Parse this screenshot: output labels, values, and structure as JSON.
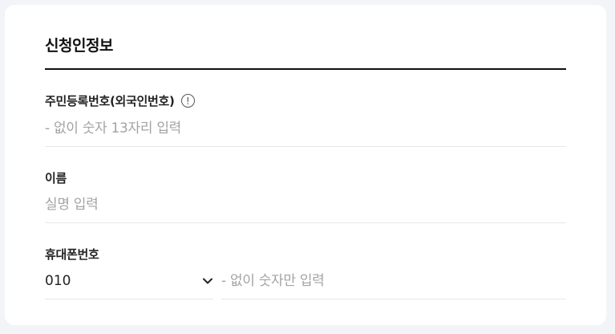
{
  "section": {
    "title": "신청인정보"
  },
  "resident_number": {
    "label": "주민등록번호(외국인번호)",
    "info_icon": "!",
    "placeholder": "- 없이 숫자 13자리 입력",
    "value": ""
  },
  "name": {
    "label": "이름",
    "placeholder": "실명 입력",
    "value": ""
  },
  "phone": {
    "label": "휴대폰번호",
    "prefix_selected": "010",
    "placeholder": "- 없이 숫자만 입력",
    "value": ""
  },
  "icons": {
    "info": "info-circle-icon",
    "dropdown": "chevron-down-icon"
  },
  "colors": {
    "background": "#f3f4f7",
    "card": "#ffffff",
    "title_rule": "#111111",
    "placeholder": "#a3a3a3",
    "divider": "#e6e6e6"
  }
}
